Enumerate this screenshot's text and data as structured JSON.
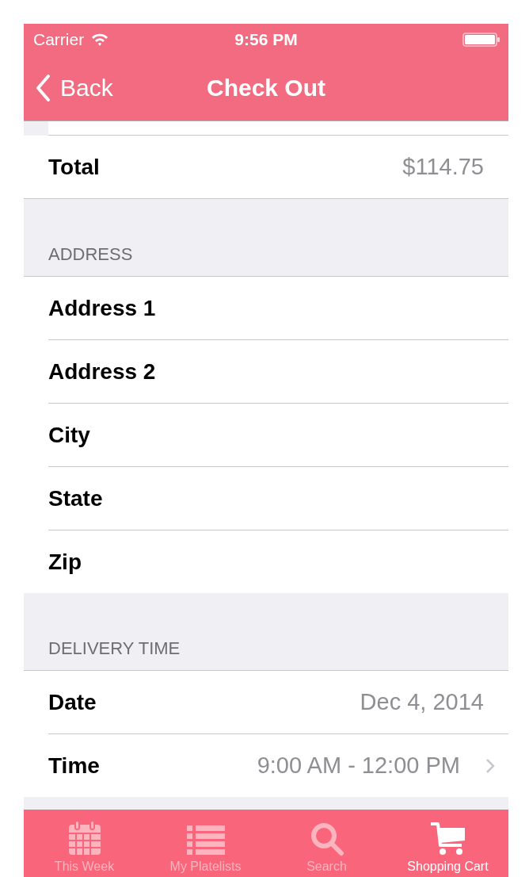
{
  "status_bar": {
    "carrier": "Carrier",
    "time": "9:56 PM"
  },
  "nav_bar": {
    "back": "Back",
    "title": "Check Out"
  },
  "total": {
    "label": "Total",
    "value": "$114.75"
  },
  "sections": [
    {
      "header": "ADDRESS",
      "rows": [
        {
          "label": "Address 1",
          "kind": "field"
        },
        {
          "label": "Address 2",
          "kind": "field"
        },
        {
          "label": "City",
          "kind": "field"
        },
        {
          "label": "State",
          "kind": "field"
        },
        {
          "label": "Zip",
          "kind": "field"
        }
      ]
    },
    {
      "header": "DELIVERY TIME",
      "rows": [
        {
          "label": "Date",
          "kind": "value",
          "value": "Dec 4, 2014"
        },
        {
          "label": "Time",
          "kind": "disclosure",
          "value": "9:00 AM - 12:00 PM"
        }
      ]
    }
  ],
  "tabs": [
    {
      "label": "This Week",
      "kind": "calendar",
      "selected": false
    },
    {
      "label": "My Platelists",
      "kind": "list",
      "selected": false
    },
    {
      "label": "Search",
      "kind": "search",
      "selected": false
    },
    {
      "label": "Shopping Cart",
      "kind": "cart",
      "selected": true
    }
  ]
}
